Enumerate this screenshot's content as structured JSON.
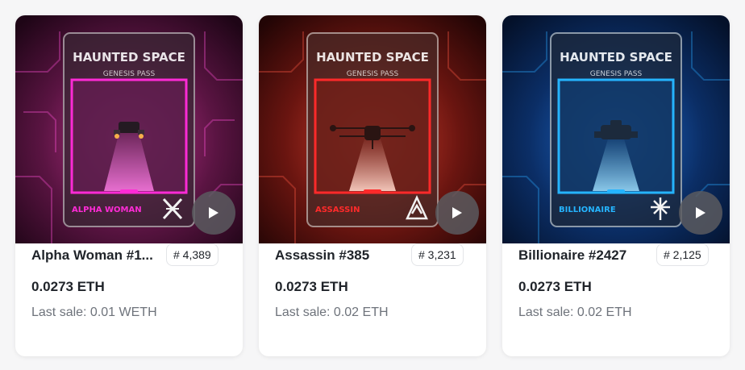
{
  "cards": [
    {
      "header_title": "HAUNTED SPACE",
      "header_subtitle": "GENESIS PASS",
      "class_label": "ALPHA WOMAN",
      "name": "Alpha Woman #1...",
      "rank": "# 4,389",
      "price": "0.0273 ETH",
      "last_sale": "Last sale: 0.01 WETH",
      "accent": "#ff2bd6",
      "bg": "#4a0f36",
      "class_icon": "crossed-swords-emblem-icon"
    },
    {
      "header_title": "HAUNTED SPACE",
      "header_subtitle": "GENESIS PASS",
      "class_label": "ASSASSIN",
      "name": "Assassin #385",
      "rank": "# 3,231",
      "price": "0.0273 ETH",
      "last_sale": "Last sale: 0.02 ETH",
      "accent": "#ff2a2a",
      "bg": "#4a0b0b",
      "class_icon": "assassin-emblem-icon"
    },
    {
      "header_title": "HAUNTED SPACE",
      "header_subtitle": "GENESIS PASS",
      "class_label": "BILLIONAIRE",
      "name": "Billionaire #2427",
      "rank": "# 2,125",
      "price": "0.0273 ETH",
      "last_sale": "Last sale: 0.02 ETH",
      "accent": "#25b4ff",
      "bg": "#06234a",
      "class_icon": "billionaire-emblem-icon"
    }
  ],
  "play_icon": "play-icon"
}
